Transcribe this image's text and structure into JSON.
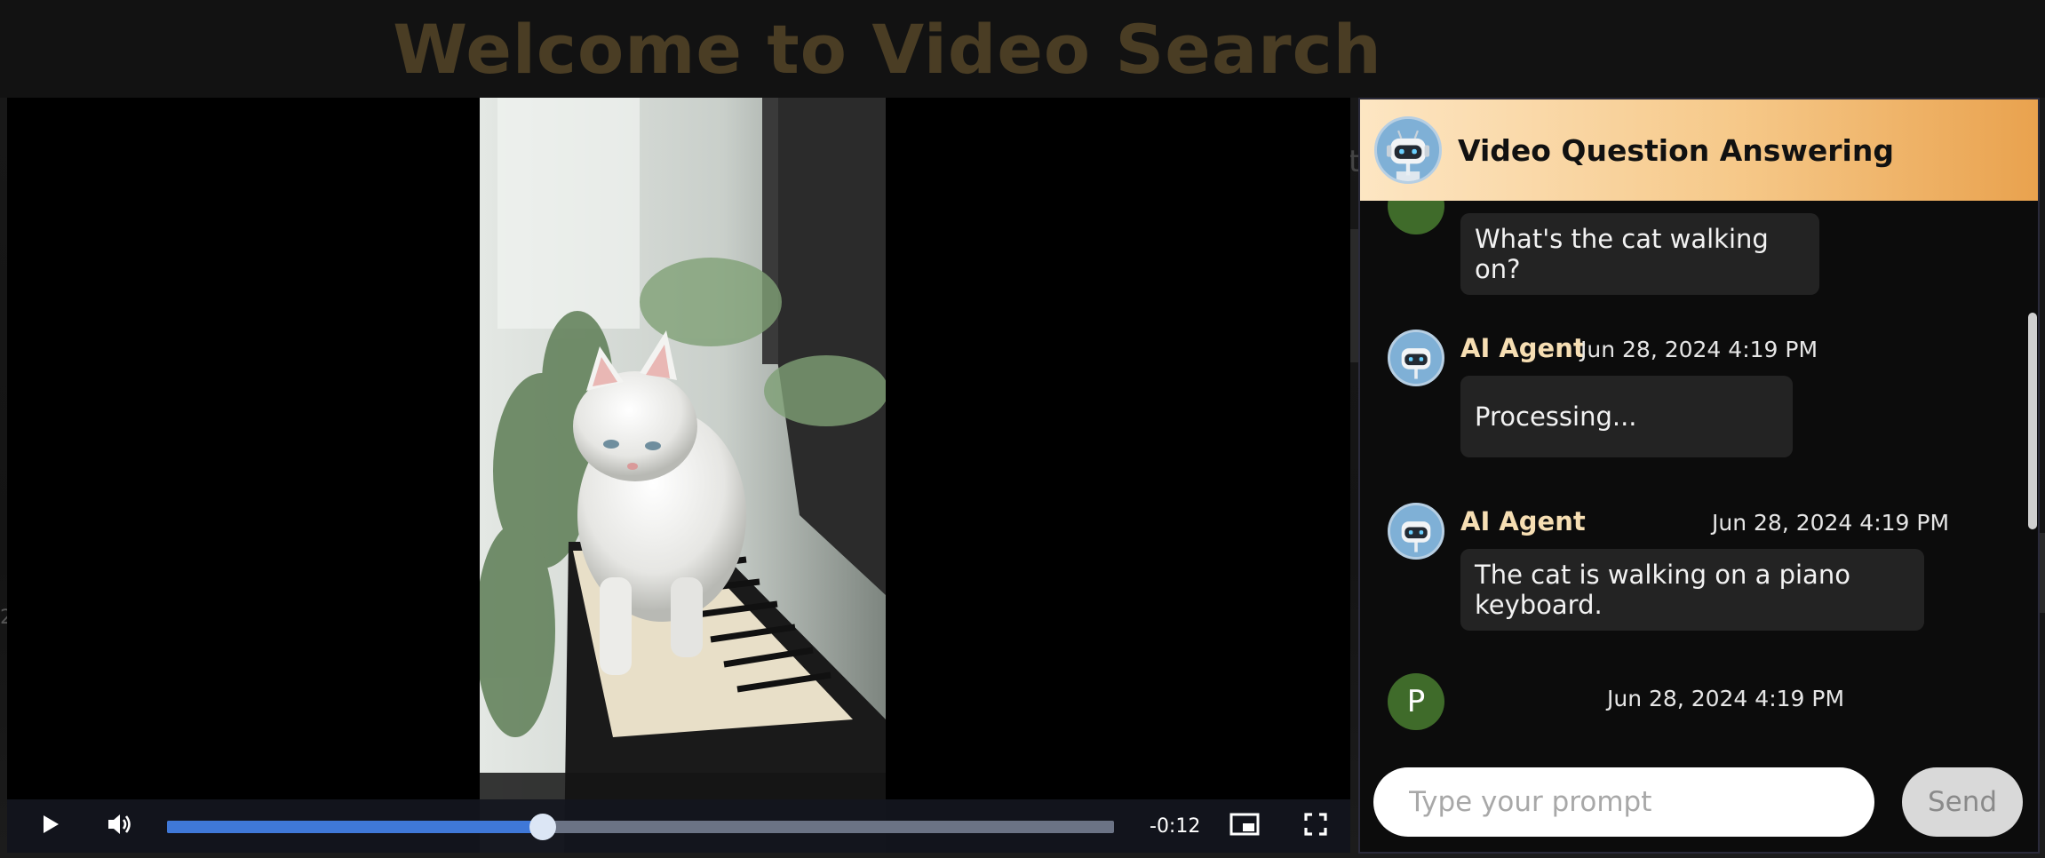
{
  "page": {
    "title": "Welcome to Video Search",
    "backdrop_number": "2",
    "backdrop_stub": "t"
  },
  "video": {
    "time_remaining": "-0:12",
    "progress": 0.397,
    "icons": {
      "play": "play-icon",
      "volume": "volume-icon",
      "pip": "picture-in-picture-icon",
      "fullscreen": "fullscreen-icon"
    }
  },
  "chat": {
    "title": "Video Question Answering",
    "messages": [
      {
        "sender": "",
        "avatar_letter": "",
        "time": "",
        "text": "What's the cat walking on?"
      },
      {
        "sender": "AI Agent",
        "time": "Jun 28, 2024 4:19 PM",
        "text": "Processing..."
      },
      {
        "sender": "AI Agent",
        "time": "Jun 28, 2024 4:19 PM",
        "text": "The cat is walking on a piano keyboard."
      },
      {
        "sender": "",
        "avatar_letter": "P",
        "time": "Jun 28, 2024 4:19 PM",
        "text": ""
      }
    ],
    "input": {
      "placeholder": "Type your prompt",
      "value": ""
    },
    "send_label": "Send"
  },
  "colors": {
    "header_gradient_start": "#fde6c3",
    "header_gradient_end": "#e9a24e",
    "sender_name": "#f6deb3",
    "progress_fill": "#3f78d8",
    "user_avatar": "#3f6b2a"
  }
}
